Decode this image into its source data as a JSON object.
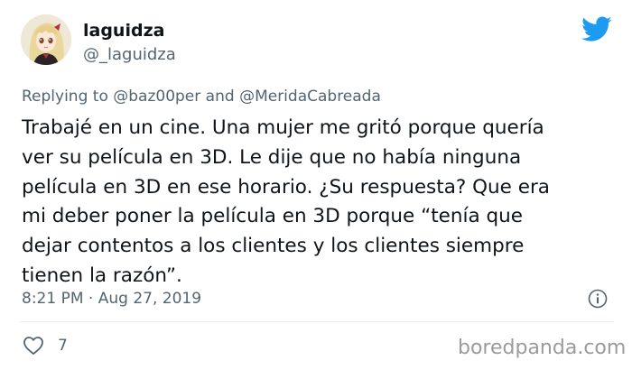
{
  "user": {
    "display_name": "laguidza",
    "handle": "@_laguidza"
  },
  "reply": {
    "prefix": "Replying to",
    "mention_1": "@baz00per",
    "and": "and",
    "mention_2": "@MeridaCabreada"
  },
  "tweet": {
    "lines": [
      "Trabajé en un cine. Una mujer me gritó porque quería",
      "ver su película en 3D. Le dije que no había ninguna",
      "película en 3D en ese horario. ¿Su respuesta? Que era",
      "mi deber poner la película en 3D porque “tenía que",
      "dejar contentos a los clientes y los clientes siempre",
      "tienen la razón”."
    ]
  },
  "meta": {
    "time": "8:21 PM",
    "separator": "·",
    "date": "Aug 27, 2019"
  },
  "actions": {
    "like_count": "7"
  },
  "watermark": "boredpanda.com",
  "icons": {
    "platform": "twitter-bird-icon",
    "info": "info-circle-icon",
    "like": "heart-icon"
  },
  "colors": {
    "twitter_blue": "#1d9bf0",
    "text": "#0f1419",
    "secondary": "#536471",
    "divider": "#e6ecf0",
    "watermark": "#9b9b9b"
  }
}
